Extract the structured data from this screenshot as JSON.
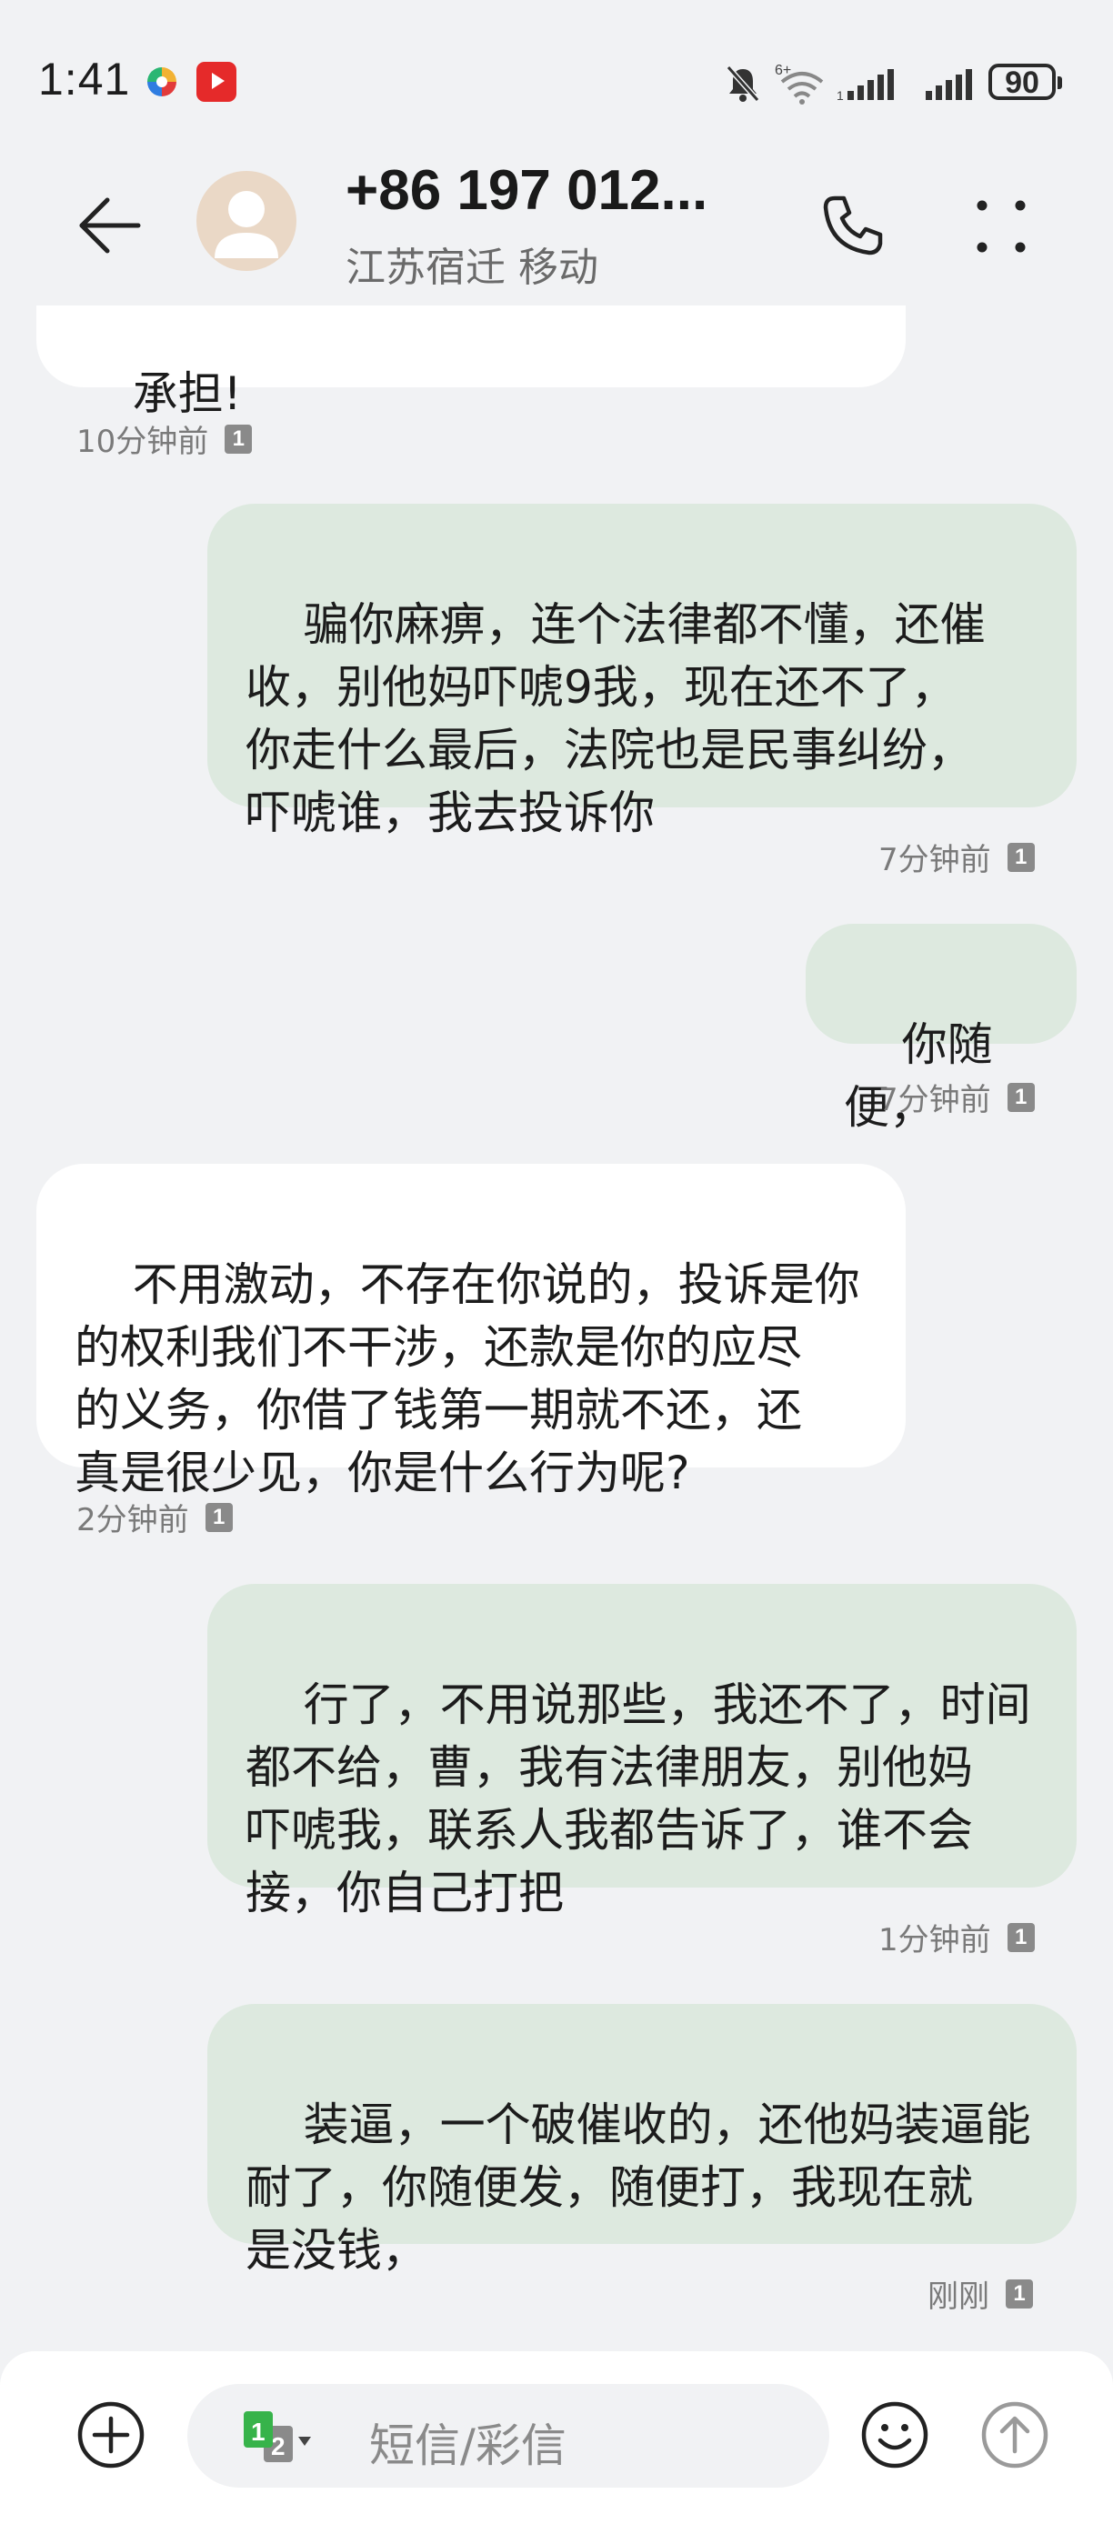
{
  "status_bar": {
    "time": "1:41",
    "battery": "90",
    "icons": [
      "colorful-app-icon",
      "video-app-icon",
      "bell-muted-icon",
      "wifi-6-icon",
      "signal-icon",
      "signal-icon"
    ]
  },
  "header": {
    "contact_name": "+86 197 012...",
    "contact_sub": "江苏宿迁 移动",
    "icons": [
      "back-arrow-icon",
      "avatar",
      "phone-icon",
      "more-icon"
    ]
  },
  "messages": [
    {
      "direction": "in",
      "text": "承担!",
      "time": "10分钟前",
      "sim": "1"
    },
    {
      "direction": "out",
      "text": "骗你麻痹，连个法律都不懂，还催\n收，别他妈吓唬9我，现在还不了，\n你走什么最后，法院也是民事纠纷，\n吓唬谁，我去投诉你",
      "time": "7分钟前",
      "sim": "1"
    },
    {
      "direction": "out",
      "text": "你随便，",
      "time": "7分钟前",
      "sim": "1"
    },
    {
      "direction": "in",
      "text": "不用激动，不存在你说的，投诉是你\n的权利我们不干涉，还款是你的应尽\n的义务，你借了钱第一期就不还，还\n真是很少见，你是什么行为呢?",
      "time": "2分钟前",
      "sim": "1"
    },
    {
      "direction": "out",
      "text": "行了，不用说那些，我还不了，时间\n都不给，曹，我有法律朋友，别他妈\n吓唬我，联系人我都告诉了，谁不会\n接，你自己打把",
      "time": "1分钟前",
      "sim": "1"
    },
    {
      "direction": "out",
      "text": "装逼，一个破催收的，还他妈装逼能\n耐了，你随便发，随便打，我现在就\n是没钱，",
      "time": "刚刚",
      "sim": "1"
    }
  ],
  "composer": {
    "placeholder": "短信/彩信",
    "sim_primary": "1",
    "sim_secondary": "2",
    "colors": {
      "sim_primary": "#37b34a",
      "sim_secondary": "#8a8a8a"
    }
  },
  "colors": {
    "background": "#f1f2f4",
    "incoming_bubble": "#ffffff",
    "outgoing_bubble": "#dde9df"
  }
}
